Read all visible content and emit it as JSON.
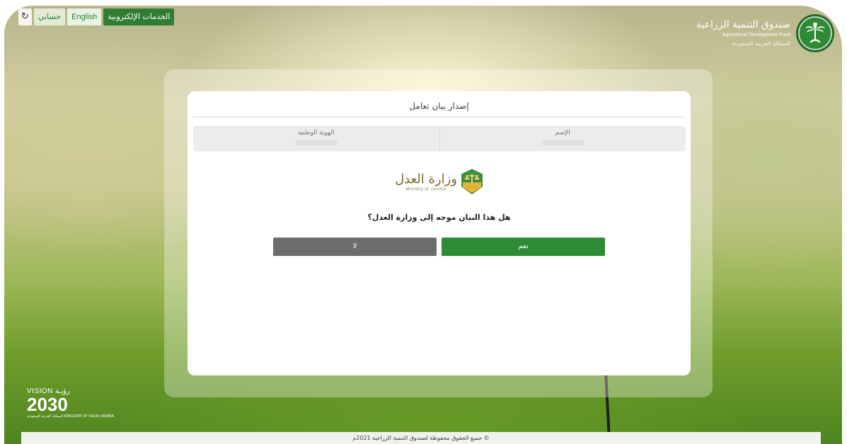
{
  "topnav": {
    "services_label": "الخدمات الإلكترونية",
    "english_label": "English",
    "account_label": "حسابي",
    "refresh_symbol": "↻"
  },
  "logo": {
    "name_ar": "صندوق التنمية الزراعية",
    "name_en": "Agricultural Development Fund",
    "kingdom_ar": "المملكة العربية السعودية"
  },
  "card": {
    "title": "إصدار بيان تعامل",
    "fields": [
      {
        "label": "الإسم"
      },
      {
        "label": "الهوية الوطنية"
      }
    ],
    "ministry_logo": {
      "name_ar": "وزارة العدل",
      "name_en": "Ministry of Justice"
    },
    "question": "هل هذا البيان موجه إلى وزارة العدل؟",
    "yes_label": "نعم",
    "no_label": "لا"
  },
  "vision": {
    "line1": "VISION رؤيـة",
    "line2": "2030",
    "line3": "المملكة العربية السعودية KINGDOM OF SAUDI ARABIA"
  },
  "footer": {
    "copyright": "© جميع الحقوق محفوظة لصندوق التنمية الزراعية 2021م"
  },
  "colors": {
    "brand_green": "#2e8b36",
    "no_gray": "#6d6d6d"
  }
}
